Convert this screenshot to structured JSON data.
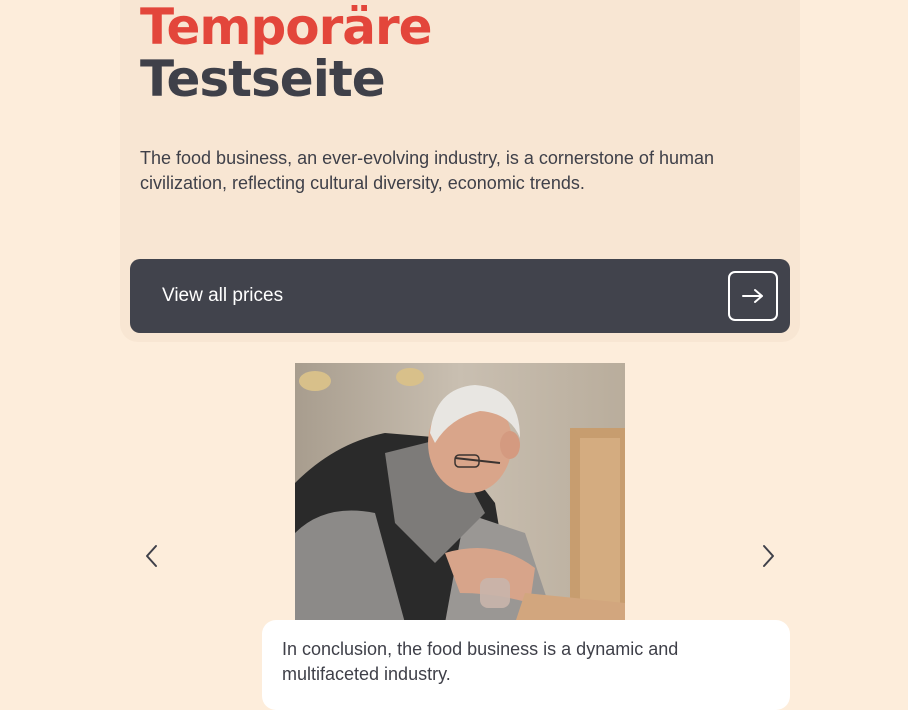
{
  "hero": {
    "title_line1": "Temporäre",
    "title_line2": "Testseite",
    "description": "The food business, an ever-evolving industry, is a cornerstone of human civilization, reflecting cultural diversity, economic trends.",
    "cta_label": "View all prices",
    "cta_icon": "arrow-right-icon"
  },
  "carousel": {
    "prev_icon": "chevron-left-icon",
    "next_icon": "chevron-right-icon",
    "image_description": "elderly man with white hair and glasses pouring from a small bottle",
    "caption": "In conclusion, the food business is a dynamic and multifaceted industry."
  },
  "colors": {
    "background": "#fdeddb",
    "card": "#f8e6d3",
    "accent": "#e3463b",
    "dark": "#41434c",
    "text": "#3f4049"
  }
}
